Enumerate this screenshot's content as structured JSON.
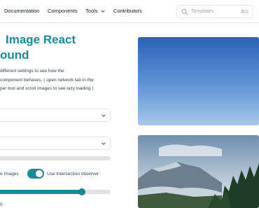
{
  "header": {
    "nav": {
      "documentation": "Documentation",
      "components": "Components",
      "tools": "Tools",
      "contributors": "Contributors"
    },
    "search": {
      "placeholder": "Templates",
      "shortcut": "⌘S"
    }
  },
  "main": {
    "title_line1": "Image React",
    "title_line2": "ound",
    "description": [
      "different settings to see how the",
      "component behaves. ( open network tab in the",
      "per tool and scroll images to see lazy loading )"
    ],
    "options": {
      "images_label": "e Images",
      "intersection_label": "Use Intersection observer",
      "intersection_enabled": true,
      "slider_fraction": 0.75
    },
    "bottom_text": "0"
  },
  "colors": {
    "accent": "#1a8a98"
  }
}
